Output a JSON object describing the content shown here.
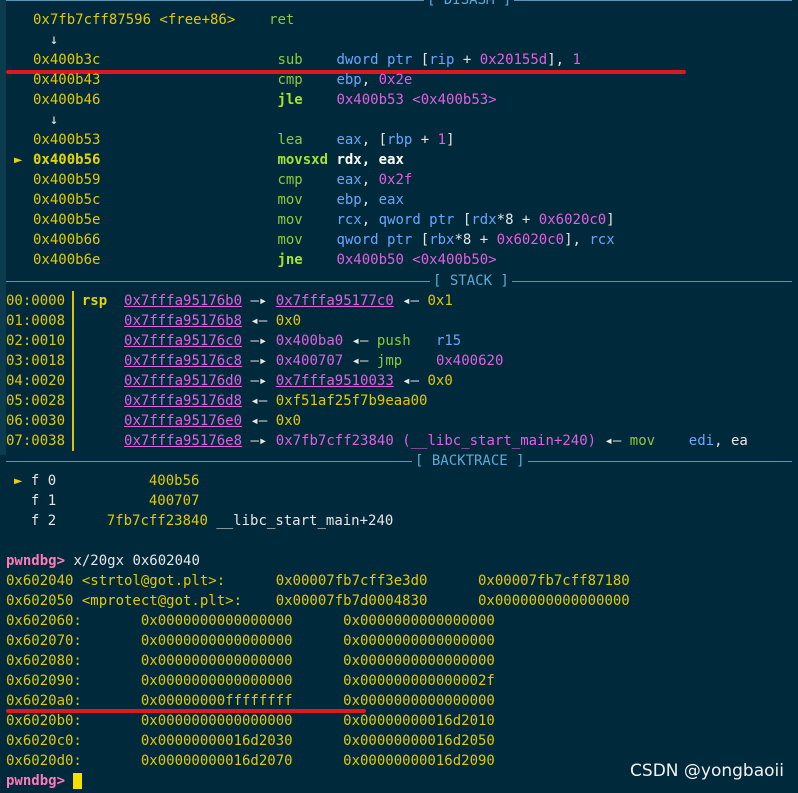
{
  "headers": {
    "disasm": "[ DISASM ]",
    "stack": "[ STACK ]",
    "backtrace": "[ BACKTRACE ]"
  },
  "disasm": [
    [
      {
        "t": "0x7fb7cff87596 <free+86>    ",
        "c": "y"
      },
      {
        "t": "ret",
        "c": "g"
      }
    ],
    [
      {
        "t": "  ↓",
        "c": "w"
      }
    ],
    [
      {
        "t": "0x400b3c                     ",
        "c": "y"
      },
      {
        "t": "sub    ",
        "c": "g"
      },
      {
        "t": "dword ptr ",
        "c": "b"
      },
      {
        "t": "[",
        "c": "w"
      },
      {
        "t": "rip",
        "c": "b"
      },
      {
        "t": " + ",
        "c": "w"
      },
      {
        "t": "0x20155d",
        "c": "m"
      },
      {
        "t": "], ",
        "c": "w"
      },
      {
        "t": "1",
        "c": "m"
      }
    ],
    [
      {
        "t": "0x400b43                     ",
        "c": "y"
      },
      {
        "t": "cmp    ",
        "c": "g"
      },
      {
        "t": "ebp",
        "c": "b"
      },
      {
        "t": ", ",
        "c": "w"
      },
      {
        "t": "0x2e",
        "c": "m"
      }
    ],
    [
      {
        "t": "0x400b46                     ",
        "c": "y"
      },
      {
        "t": "jle    ",
        "c": "gb"
      },
      {
        "t": "0x400b53 <0x400b53>",
        "c": "m"
      }
    ],
    [
      {
        "t": "  ↓",
        "c": "w"
      }
    ],
    [
      {
        "t": "0x400b53                     ",
        "c": "y"
      },
      {
        "t": "lea    ",
        "c": "g"
      },
      {
        "t": "eax",
        "c": "b"
      },
      {
        "t": ", [",
        "c": "w"
      },
      {
        "t": "rbp",
        "c": "b"
      },
      {
        "t": " + ",
        "c": "w"
      },
      {
        "t": "1",
        "c": "m"
      },
      {
        "t": "]",
        "c": "w"
      }
    ],
    [
      {
        "t": "0x400b56                     ",
        "c": "yb"
      },
      {
        "t": "movsxd ",
        "c": "gb"
      },
      {
        "t": "rdx",
        "c": "wb"
      },
      {
        "t": ", ",
        "c": "wb"
      },
      {
        "t": "eax",
        "c": "wb"
      }
    ],
    [
      {
        "t": "0x400b59                     ",
        "c": "y"
      },
      {
        "t": "cmp    ",
        "c": "g"
      },
      {
        "t": "eax",
        "c": "b"
      },
      {
        "t": ", ",
        "c": "w"
      },
      {
        "t": "0x2f",
        "c": "m"
      }
    ],
    [
      {
        "t": "0x400b5c                     ",
        "c": "y"
      },
      {
        "t": "mov    ",
        "c": "g"
      },
      {
        "t": "ebp",
        "c": "b"
      },
      {
        "t": ", ",
        "c": "w"
      },
      {
        "t": "eax",
        "c": "b"
      }
    ],
    [
      {
        "t": "0x400b5e                     ",
        "c": "y"
      },
      {
        "t": "mov    ",
        "c": "g"
      },
      {
        "t": "rcx",
        "c": "b"
      },
      {
        "t": ", ",
        "c": "w"
      },
      {
        "t": "qword ptr ",
        "c": "b"
      },
      {
        "t": "[",
        "c": "w"
      },
      {
        "t": "rdx",
        "c": "b"
      },
      {
        "t": "*8 + ",
        "c": "w"
      },
      {
        "t": "0x6020c0",
        "c": "m"
      },
      {
        "t": "]",
        "c": "w"
      }
    ],
    [
      {
        "t": "0x400b66                     ",
        "c": "y"
      },
      {
        "t": "mov    ",
        "c": "g"
      },
      {
        "t": "qword ptr ",
        "c": "b"
      },
      {
        "t": "[",
        "c": "w"
      },
      {
        "t": "rbx",
        "c": "b"
      },
      {
        "t": "*8 + ",
        "c": "w"
      },
      {
        "t": "0x6020c0",
        "c": "m"
      },
      {
        "t": "], ",
        "c": "w"
      },
      {
        "t": "rcx",
        "c": "b"
      }
    ],
    [
      {
        "t": "0x400b6e                     ",
        "c": "y"
      },
      {
        "t": "jne    ",
        "c": "gb"
      },
      {
        "t": "0x400b50 <0x400b50>",
        "c": "m"
      }
    ]
  ],
  "current_marker": "►",
  "stack": [
    [
      {
        "t": "00:0000",
        "c": "y"
      },
      {
        "t": "  ",
        "c": "w"
      },
      {
        "t": "rsp",
        "c": "yb"
      },
      {
        "t": "  ",
        "c": "w"
      },
      {
        "t": "0x7fffa95176b0",
        "c": "m",
        "u": 1
      },
      {
        "t": " —▸ ",
        "c": "w"
      },
      {
        "t": "0x7fffa95177c0",
        "c": "m",
        "u": 1
      },
      {
        "t": " ◂— ",
        "c": "w"
      },
      {
        "t": "0x1",
        "c": "y"
      }
    ],
    [
      {
        "t": "01:0008",
        "c": "y"
      },
      {
        "t": "       ",
        "c": "w"
      },
      {
        "t": "0x7fffa95176b8",
        "c": "m",
        "u": 1
      },
      {
        "t": " ◂— ",
        "c": "w"
      },
      {
        "t": "0x0",
        "c": "y"
      }
    ],
    [
      {
        "t": "02:0010",
        "c": "y"
      },
      {
        "t": "       ",
        "c": "w"
      },
      {
        "t": "0x7fffa95176c0",
        "c": "m",
        "u": 1
      },
      {
        "t": " —▸ ",
        "c": "w"
      },
      {
        "t": "0x400ba0",
        "c": "m"
      },
      {
        "t": " ◂— ",
        "c": "w"
      },
      {
        "t": "push",
        "c": "g"
      },
      {
        "t": "   ",
        "c": "w"
      },
      {
        "t": "r15",
        "c": "b"
      }
    ],
    [
      {
        "t": "03:0018",
        "c": "y"
      },
      {
        "t": "       ",
        "c": "w"
      },
      {
        "t": "0x7fffa95176c8",
        "c": "m",
        "u": 1
      },
      {
        "t": " —▸ ",
        "c": "w"
      },
      {
        "t": "0x400707",
        "c": "m"
      },
      {
        "t": " ◂— ",
        "c": "w"
      },
      {
        "t": "jmp",
        "c": "g"
      },
      {
        "t": "    ",
        "c": "w"
      },
      {
        "t": "0x400620",
        "c": "m"
      }
    ],
    [
      {
        "t": "04:0020",
        "c": "y"
      },
      {
        "t": "       ",
        "c": "w"
      },
      {
        "t": "0x7fffa95176d0",
        "c": "m",
        "u": 1
      },
      {
        "t": " —▸ ",
        "c": "w"
      },
      {
        "t": "0x7fffa9510033",
        "c": "m",
        "u": 1
      },
      {
        "t": " ◂— ",
        "c": "w"
      },
      {
        "t": "0x0",
        "c": "y"
      }
    ],
    [
      {
        "t": "05:0028",
        "c": "y"
      },
      {
        "t": "       ",
        "c": "w"
      },
      {
        "t": "0x7fffa95176d8",
        "c": "m",
        "u": 1
      },
      {
        "t": " ◂— ",
        "c": "w"
      },
      {
        "t": "0xf51af25f7b9eaa00",
        "c": "y"
      }
    ],
    [
      {
        "t": "06:0030",
        "c": "y"
      },
      {
        "t": "       ",
        "c": "w"
      },
      {
        "t": "0x7fffa95176e0",
        "c": "m",
        "u": 1
      },
      {
        "t": " ◂— ",
        "c": "w"
      },
      {
        "t": "0x0",
        "c": "y"
      }
    ],
    [
      {
        "t": "07:0038",
        "c": "y"
      },
      {
        "t": "       ",
        "c": "w"
      },
      {
        "t": "0x7fffa95176e8",
        "c": "m",
        "u": 1
      },
      {
        "t": " —▸ ",
        "c": "w"
      },
      {
        "t": "0x7fb7cff23840 (__libc_start_main+240)",
        "c": "m"
      },
      {
        "t": " ◂— ",
        "c": "w"
      },
      {
        "t": "mov",
        "c": "g"
      },
      {
        "t": "    ",
        "c": "w"
      },
      {
        "t": "edi",
        "c": "b"
      },
      {
        "t": ", ea",
        "c": "w"
      }
    ]
  ],
  "backtrace": [
    [
      {
        "t": "► ",
        "c": "yb"
      },
      {
        "t": "f 0",
        "c": "w"
      },
      {
        "t": "           ",
        "c": "w"
      },
      {
        "t": "400b56",
        "c": "y"
      }
    ],
    [
      {
        "t": "  ",
        "c": "w"
      },
      {
        "t": "f 1",
        "c": "w"
      },
      {
        "t": "           ",
        "c": "w"
      },
      {
        "t": "400707",
        "c": "y"
      }
    ],
    [
      {
        "t": "  ",
        "c": "w"
      },
      {
        "t": "f 2",
        "c": "w"
      },
      {
        "t": "      ",
        "c": "w"
      },
      {
        "t": "7fb7cff23840",
        "c": "y"
      },
      {
        "t": " __libc_start_main+240",
        "c": "w"
      }
    ]
  ],
  "prompt": "pwndbg>",
  "command": " x/20gx 0x602040",
  "dump": [
    [
      {
        "t": "0x602040 <strtol@got.plt>:      ",
        "c": "y"
      },
      {
        "t": "0x00007fb7cff3e3d0      0x00007fb7cff87180",
        "c": "y"
      }
    ],
    [
      {
        "t": "0x602050 <mprotect@got.plt>:    ",
        "c": "y"
      },
      {
        "t": "0x00007fb7d0004830      0x0000000000000000",
        "c": "y"
      }
    ],
    [
      {
        "t": "0x602060:       ",
        "c": "y"
      },
      {
        "t": "0x0000000000000000      0x0000000000000000",
        "c": "y"
      }
    ],
    [
      {
        "t": "0x602070:       ",
        "c": "y"
      },
      {
        "t": "0x0000000000000000      0x0000000000000000",
        "c": "y"
      }
    ],
    [
      {
        "t": "0x602080:       ",
        "c": "y"
      },
      {
        "t": "0x0000000000000000      0x0000000000000000",
        "c": "y"
      }
    ],
    [
      {
        "t": "0x602090:       ",
        "c": "y"
      },
      {
        "t": "0x0000000000000000      0x000000000000002f",
        "c": "y"
      }
    ],
    [
      {
        "t": "0x6020a0:       ",
        "c": "y"
      },
      {
        "t": "0x00000000ffffffff      0x0000000000000000",
        "c": "y"
      }
    ],
    [
      {
        "t": "0x6020b0:       ",
        "c": "y"
      },
      {
        "t": "0x0000000000000000      0x00000000016d2010",
        "c": "y"
      }
    ],
    [
      {
        "t": "0x6020c0:       ",
        "c": "y"
      },
      {
        "t": "0x00000000016d2030      0x00000000016d2050",
        "c": "y"
      }
    ],
    [
      {
        "t": "0x6020d0:       ",
        "c": "y"
      },
      {
        "t": "0x00000000016d2070      0x00000000016d2090",
        "c": "y"
      }
    ]
  ],
  "watermark": "CSDN @yongbaoii",
  "colors": {
    "background": "#002a3b",
    "address": "#e4c900",
    "mnemonic": "#8fc93a",
    "register": "#6aa6ff",
    "pointer": "#e060e0",
    "prompt": "#ff7ab8",
    "header_line": "#5a93b8",
    "annotation_red": "#e0171e"
  }
}
